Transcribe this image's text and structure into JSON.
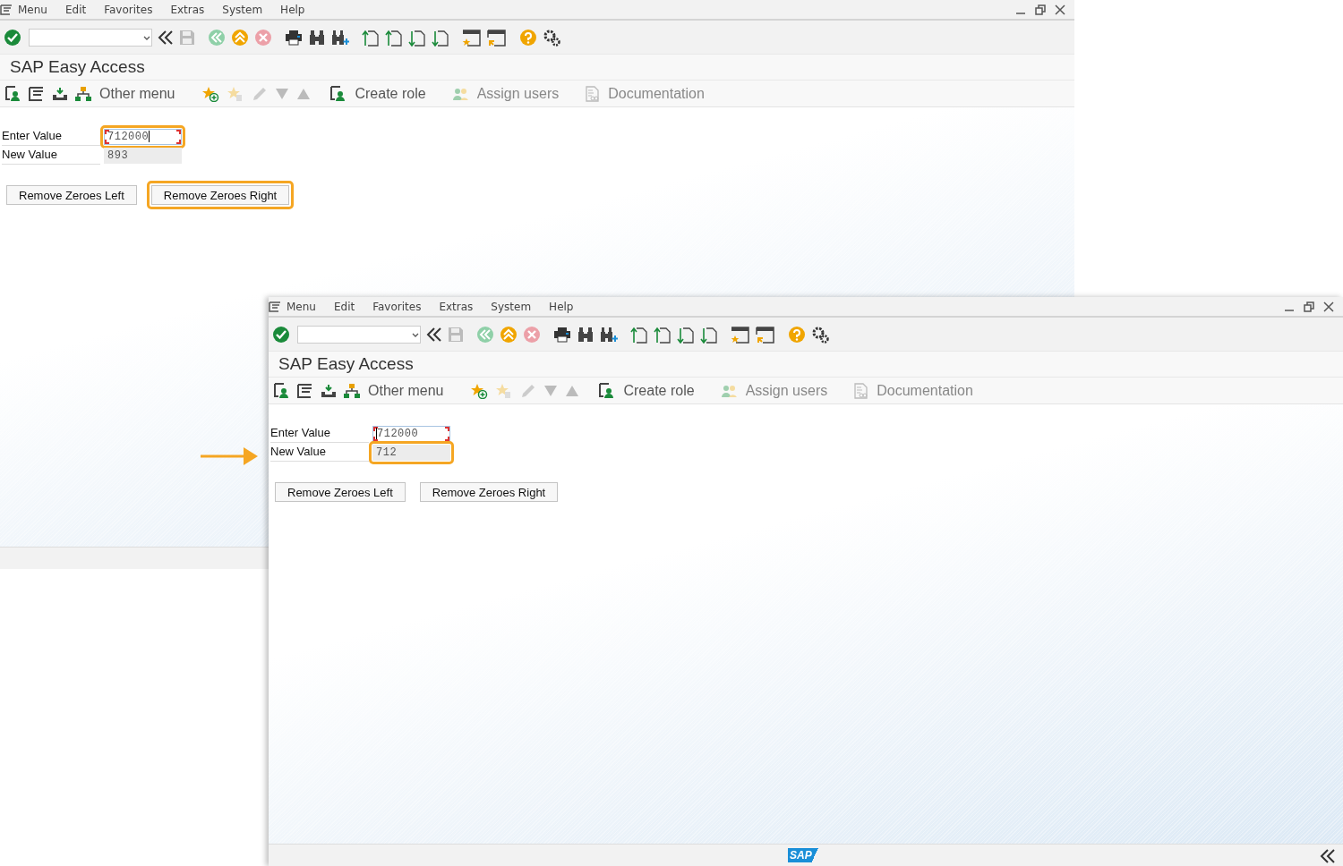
{
  "screens": [
    {
      "menu": [
        "Menu",
        "Edit",
        "Favorites",
        "Extras",
        "System",
        "Help"
      ],
      "title": "SAP Easy Access",
      "app_toolbar": [
        {
          "label": "Other menu",
          "disabled": false
        },
        {
          "label": "Create role",
          "disabled": false
        },
        {
          "label": "Assign users",
          "disabled": true
        },
        {
          "label": "Documentation",
          "disabled": true
        }
      ],
      "fields": [
        {
          "label": "Enter Value",
          "value": "712000",
          "editable": true,
          "focused": true,
          "cursor_at_start": false,
          "highlighted": true
        },
        {
          "label": "New Value",
          "value": "893",
          "editable": false,
          "focused": false,
          "highlighted": false
        }
      ],
      "buttons": [
        {
          "label": "Remove Zeroes Left",
          "highlighted": false
        },
        {
          "label": "Remove Zeroes Right",
          "highlighted": true
        }
      ]
    },
    {
      "menu": [
        "Menu",
        "Edit",
        "Favorites",
        "Extras",
        "System",
        "Help"
      ],
      "title": "SAP Easy Access",
      "app_toolbar": [
        {
          "label": "Other menu",
          "disabled": false
        },
        {
          "label": "Create role",
          "disabled": false
        },
        {
          "label": "Assign users",
          "disabled": true
        },
        {
          "label": "Documentation",
          "disabled": true
        }
      ],
      "fields": [
        {
          "label": "Enter Value",
          "value": "712000",
          "editable": true,
          "focused": true,
          "cursor_at_start": true,
          "highlighted": false
        },
        {
          "label": "New Value",
          "value": "712",
          "editable": false,
          "focused": false,
          "highlighted": true
        }
      ],
      "buttons": [
        {
          "label": "Remove Zeroes Left",
          "highlighted": false
        },
        {
          "label": "Remove Zeroes Right",
          "highlighted": false
        }
      ],
      "status_bar": {
        "logo": "SAP"
      }
    }
  ]
}
